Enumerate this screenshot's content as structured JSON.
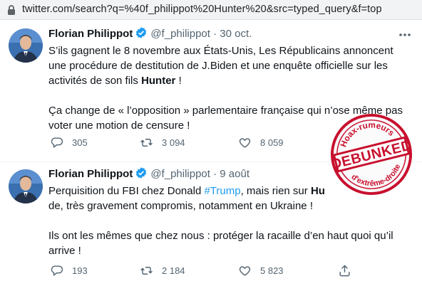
{
  "browser": {
    "url": "twitter.com/search?q=%40f_philippot%20Hunter%20&src=typed_query&f=top"
  },
  "tweets": [
    {
      "name": "Florian Philippot",
      "handle": "@f_philippot",
      "separator": "·",
      "date": "30 oct.",
      "lines": {
        "l1": "S’ils gagnent le 8 novembre aux États-Unis, Les Républicains annoncent",
        "l2": "une procédure de destitution de J.Biden et une enquête officielle sur les",
        "l3a": "activités de son fils ",
        "l3b": "Hunter",
        "l3c": " !",
        "l4": "Ça change de « l’opposition » parlementaire française qui n’ose même pas",
        "l5": "voter une motion de censure !"
      },
      "replies": "305",
      "retweets": "3 094",
      "likes": "8 059"
    },
    {
      "name": "Florian Philippot",
      "handle": "@f_philippot",
      "separator": "·",
      "date": "9 août",
      "lines": {
        "l1a": "Perquisition du FBI chez Donald ",
        "l1b": "#Trump",
        "l1c": ", mais rien sur ",
        "l1d": "Hu",
        "l2": "de, très gravement compromis, notamment en Ukraine !",
        "l3": "Ils ont les mêmes que chez nous : protéger la racaille d’en haut quoi qu’il",
        "l4": "arrive !"
      },
      "replies": "193",
      "retweets": "2 184",
      "likes": "5 823"
    }
  ],
  "stamp": {
    "top_text": "Hoax-rumeurs",
    "main_text": "DEBUNKED",
    "bottom_text": "d'extrême-droite",
    "color": "#c8102e"
  },
  "colors": {
    "accent": "#1d9bf0",
    "text": "#0f1419",
    "muted": "#536471"
  }
}
